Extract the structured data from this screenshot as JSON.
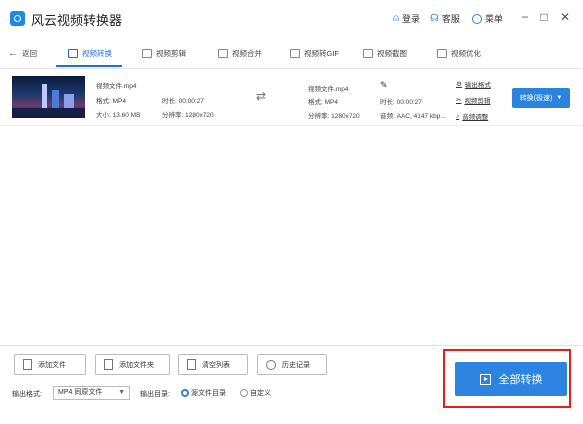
{
  "app": {
    "title": "风云视频转换器"
  },
  "titlebar": {
    "login": "登录",
    "service": "客服",
    "menu": "菜单",
    "minimize": "−",
    "maximize": "□",
    "close": "✕"
  },
  "nav": {
    "back": "返回",
    "tabs": [
      {
        "label": "视频转换",
        "active": true
      },
      {
        "label": "视频剪辑"
      },
      {
        "label": "视频合并"
      },
      {
        "label": "视频转GIF"
      },
      {
        "label": "视频截图"
      },
      {
        "label": "视频优化"
      }
    ]
  },
  "file": {
    "source": {
      "name": "视频文件.mp4",
      "format": "格式: MP4",
      "size": "大小: 13.60 MB",
      "duration": "时长: 00:00:27",
      "resolution": "分辨率: 1280x720"
    },
    "output": {
      "name": "视频文件.mp4",
      "format": "格式: MP4",
      "duration": "时长: 00:00:27",
      "resolution": "分辨率: 1280x720",
      "audio": "音频: AAC, 4147 kbp..."
    },
    "actions": [
      "输出格式",
      "视频剪辑",
      "音频调整"
    ],
    "convert_button": "转换(极速)"
  },
  "bottom": {
    "buttons": [
      "添加文件",
      "添加文件夹",
      "清空列表",
      "历史记录"
    ],
    "output_format_label": "输出格式:",
    "output_format_value": "MP4 同原文件",
    "output_dir_label": "输出目录:",
    "dir_options": [
      "源文件目录",
      "自定义"
    ],
    "convert_all": "全部转换"
  },
  "colors": {
    "accent": "#2b83e0",
    "highlight_box": "#e02020"
  }
}
